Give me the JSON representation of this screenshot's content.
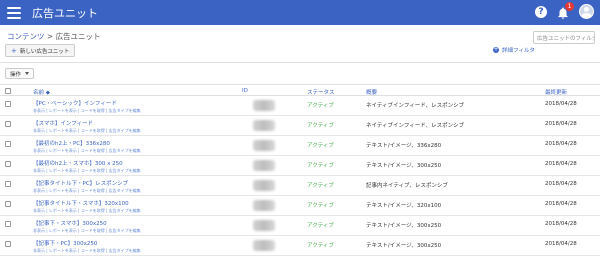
{
  "header": {
    "app_title": "広告ユニット",
    "help_label": "?",
    "notification_count": "1"
  },
  "breadcrumb": {
    "parent": "コンテンツ",
    "separator": " > ",
    "current": "広告ユニット"
  },
  "toolbar": {
    "new_button_label": "新しい広告ユニット",
    "filter_placeholder": "広告ユニットのフィルタ",
    "advanced_filter_label": "詳細フィルタ",
    "actions_label": "操作"
  },
  "table": {
    "headers": {
      "name": "名前 ◆",
      "id": "ID",
      "status": "ステータス",
      "summary": "概要",
      "updated": "最終更新"
    },
    "sublinks": "非表示 | レポートを表示 | コードを取得 | 広告タイプを編集",
    "rows": [
      {
        "name": "【PC・ベーシック】インフィード",
        "status": "アクティブ",
        "summary": "ネイティブインフィード、レスポンシブ",
        "updated": "2018/04/28"
      },
      {
        "name": "【スマホ】インフィード",
        "status": "アクティブ",
        "summary": "ネイティブインフィード、レスポンシブ",
        "updated": "2018/04/28"
      },
      {
        "name": "【最初のh2上・PC】336x280",
        "status": "アクティブ",
        "summary": "テキスト/イメージ、336x280",
        "updated": "2018/04/28"
      },
      {
        "name": "【最初のh2上・スマホ】300 x 250",
        "status": "アクティブ",
        "summary": "テキスト/イメージ、300x250",
        "updated": "2018/04/28"
      },
      {
        "name": "【記事タイトル下・PC】レスポンシブ",
        "status": "アクティブ",
        "summary": "記事内ネイティブ、レスポンシブ",
        "updated": "2018/04/28"
      },
      {
        "name": "【記事タイトル下・スマホ】320x100",
        "status": "アクティブ",
        "summary": "テキスト/イメージ、320x100",
        "updated": "2018/04/28"
      },
      {
        "name": "【記事下・スマホ】300x250",
        "status": "アクティブ",
        "summary": "テキスト/イメージ、300x250",
        "updated": "2018/04/28"
      },
      {
        "name": "【記事下・PC】300x250",
        "status": "アクティブ",
        "summary": "テキスト/イメージ、300x250",
        "updated": "2018/04/28"
      }
    ]
  },
  "colors": {
    "brand": "#3b63c4",
    "status_active": "#4caf50",
    "badge": "#e53935"
  }
}
